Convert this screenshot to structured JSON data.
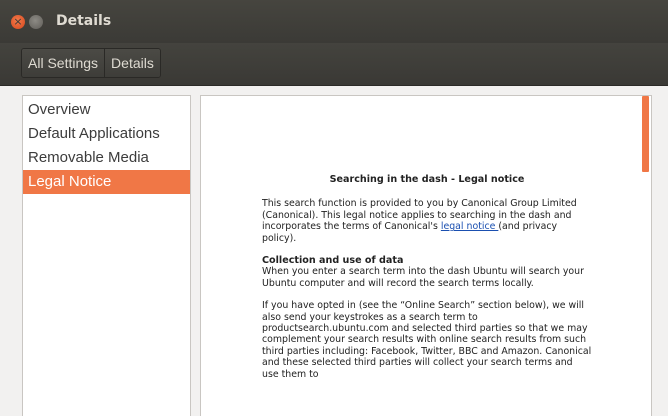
{
  "window": {
    "title": "Details"
  },
  "toolbar": {
    "breadcrumbs": [
      "All Settings",
      "Details"
    ]
  },
  "sidebar": {
    "items": [
      {
        "label": "Overview"
      },
      {
        "label": "Default Applications"
      },
      {
        "label": "Removable Media"
      },
      {
        "label": "Legal Notice",
        "selected": true
      }
    ]
  },
  "content": {
    "heading": "Searching in the dash - Legal notice",
    "intro_before_link": "This search function is provided to you by Canonical Group Limited (Canonical). This legal notice applies to searching in the dash and incorporates the terms of Canonical's ",
    "intro_link": "legal notice ",
    "intro_after_link": "(and privacy policy).",
    "section_title": "Collection and use of data",
    "section_body": "When you enter a search term into the dash Ubuntu will search your Ubuntu computer and will record the search terms locally.",
    "paragraph2": "If you have opted in (see the “Online Search” section below), we will also send your keystrokes as a search term to productsearch.ubuntu.com and selected third parties so that we may complement your search results with online search results from such third parties including: Facebook, Twitter, BBC and Amazon. Canonical and these selected third parties will collect your search terms and use them to"
  },
  "colors": {
    "accent": "#f07746",
    "titlebar": "#3c3b37",
    "link": "#1a4fb0"
  },
  "icons": {
    "close": "close-icon",
    "minimize": "minimize-icon"
  }
}
